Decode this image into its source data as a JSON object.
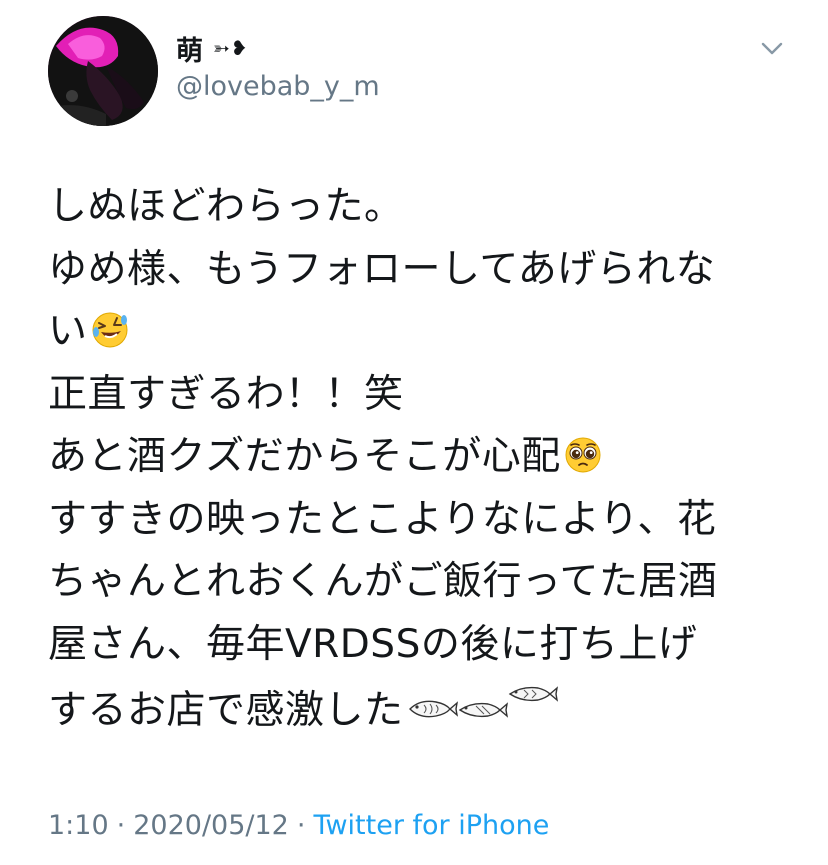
{
  "user": {
    "display_name": "萌",
    "name_decoration": "➳❥",
    "handle": "@lovebab_y_m"
  },
  "tweet": {
    "lines": [
      "しぬほどわらった。",
      "ゆめ様、もうフォローしてあげられな",
      "い",
      "正直すぎるわ！！笑",
      "あと酒クズだからそこが心配",
      "すすきの映ったとこよりなにより、花",
      "ちゃんとれおくんがご飯行ってた居酒",
      "屋さん、毎年VRDSSの後に打ち上げ",
      "するお店で感激した"
    ],
    "emojis": {
      "line3": "rolling-on-floor-laughing-emoji",
      "line5": "pleading-face-emoji",
      "line9": "fish-emoji"
    }
  },
  "footer": {
    "time": "1:10",
    "separator": "·",
    "date": "2020/05/12",
    "source": "Twitter for iPhone"
  },
  "colors": {
    "text": "#14171a",
    "secondary": "#657786",
    "link": "#1da1f2"
  }
}
